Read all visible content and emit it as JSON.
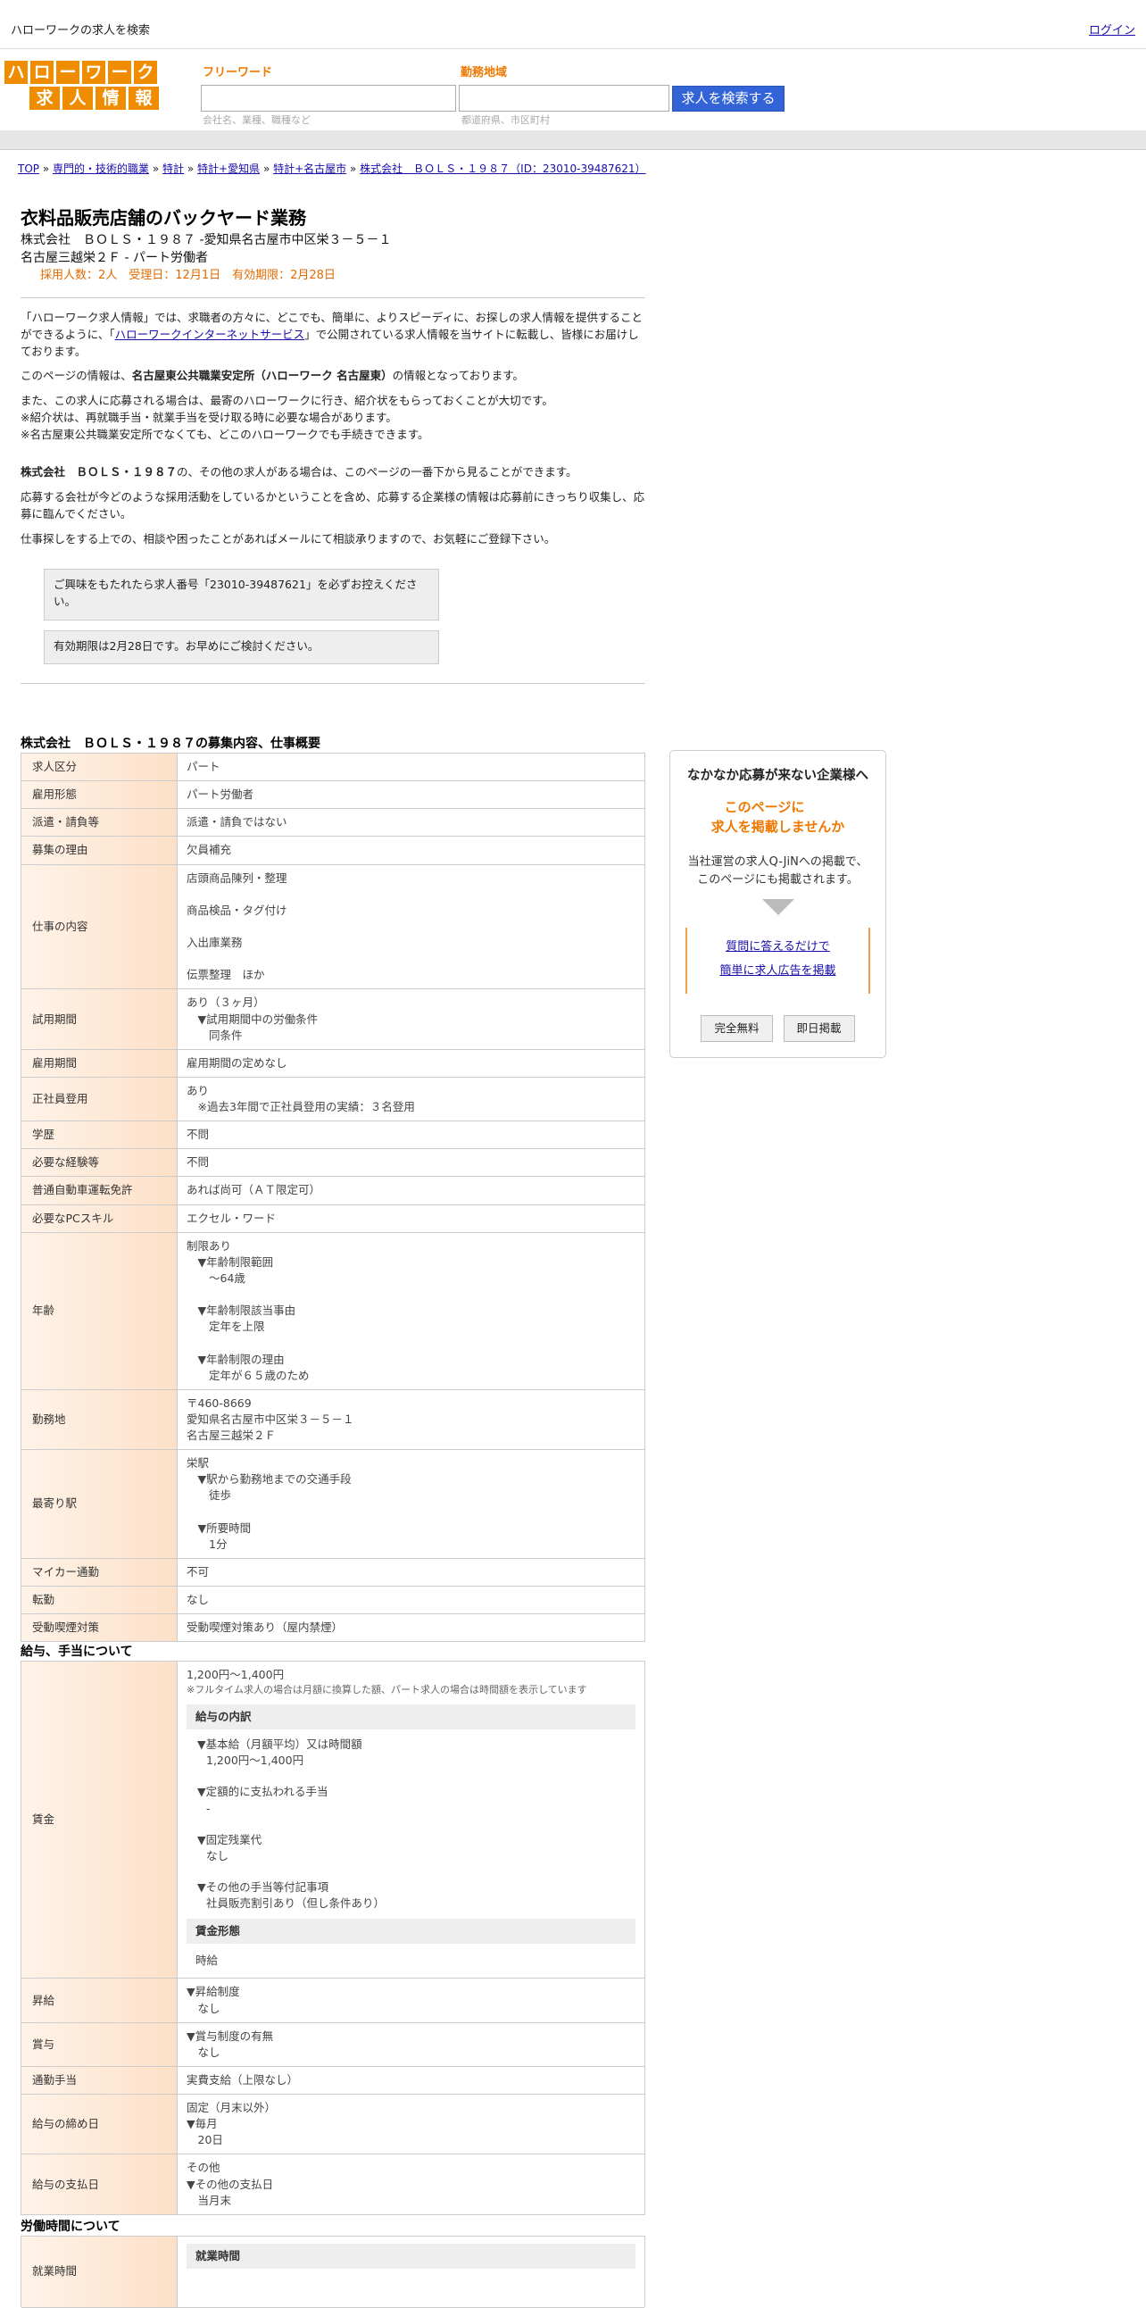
{
  "header": {
    "title": "ハローワークの求人を検索",
    "login": "ログイン"
  },
  "logo": {
    "row1": [
      "ハ",
      "ロ",
      "ー",
      "ワ",
      "ー",
      "ク"
    ],
    "row2": [
      "求",
      "人",
      "情",
      "報"
    ]
  },
  "search": {
    "keyword_label": "フリーワード",
    "area_label": "勤務地域",
    "keyword_hint": "会社名、業種、職種など",
    "area_hint": "都道府県、市区町村",
    "button": "求人を検索する"
  },
  "breadcrumb": [
    "TOP",
    "専門的・技術的職業",
    "特計",
    "特計+愛知県",
    "特計+名古屋市",
    "株式会社　ＢＯＬＳ・１９８７（ID：23010-39487621）"
  ],
  "breadcrumb_sep": "»",
  "job": {
    "title": "衣料品販売店舗のバックヤード業務",
    "line1": "株式会社　ＢＯＬＳ・１９８７ -愛知県名古屋市中区栄３－５－１",
    "line2": "名古屋三越栄２Ｆ - パート労働者",
    "meta": "採用人数：2人　受理日：12月1日　有効期限：2月28日"
  },
  "intro": {
    "p1a": "「ハローワーク求人情報」では、求職者の方々に、どこでも、簡単に、よりスピーディに、お探しの求人情報を提供することができるように、「",
    "p1link": "ハローワークインターネットサービス",
    "p1b": "」で公開されている求人情報を当サイトに転載し、皆様にお届けしております。",
    "p2a": "このページの情報は、",
    "p2b": "名古屋東公共職業安定所（ハローワーク 名古屋東）",
    "p2c": "の情報となっております。",
    "p3": "また、この求人に応募される場合は、最寄のハローワークに行き、紹介状をもらっておくことが大切です。",
    "p4": "※紹介状は、再就職手当・就業手当を受け取る時に必要な場合があります。",
    "p5": "※名古屋東公共職業安定所でなくても、どこのハローワークでも手続きできます。",
    "p6a": "株式会社　ＢＯＬＳ・１９８７",
    "p6b": "の、その他の求人がある場合は、このページの一番下から見ることができます。",
    "p7": "応募する会社が今どのような採用活動をしているかということを含め、応募する企業様の情報は応募前にきっちり収集し、応募に臨んでください。",
    "p8": "仕事探しをする上での、相談や困ったことがあればメールにて相談承りますので、お気軽にご登録下さい。"
  },
  "notes": {
    "n1": "ご興味をもたれたら求人番号「23010-39487621」を必ずお控えください。",
    "n2": "有効期限は2月28日です。お早めにご検討ください。"
  },
  "section1": {
    "title": "株式会社　ＢＯＬＳ・１９８７の募集内容、仕事概要",
    "rows": [
      {
        "h": "求人区分",
        "v": [
          "パート"
        ]
      },
      {
        "h": "雇用形態",
        "v": [
          "パート労働者"
        ]
      },
      {
        "h": "派遣・請負等",
        "v": [
          "派遣・請負ではない"
        ]
      },
      {
        "h": "募集の理由",
        "v": [
          "欠員補充"
        ]
      },
      {
        "h": "仕事の内容",
        "v": [
          "店頭商品陳列・整理",
          "",
          "商品検品・タグ付け",
          "",
          "入出庫業務",
          "",
          "伝票整理　ほか"
        ]
      },
      {
        "h": "試用期間",
        "v": [
          "あり（３ヶ月）",
          "　▼試用期間中の労働条件",
          "　　同条件"
        ]
      },
      {
        "h": "雇用期間",
        "v": [
          "雇用期間の定めなし"
        ]
      },
      {
        "h": "正社員登用",
        "v": [
          "あり",
          "　※過去3年間で正社員登用の実績：３名登用"
        ]
      },
      {
        "h": "学歴",
        "v": [
          "不問"
        ]
      },
      {
        "h": "必要な経験等",
        "v": [
          "不問"
        ]
      },
      {
        "h": "普通自動車運転免許",
        "v": [
          "あれば尚可（ＡＴ限定可）"
        ]
      },
      {
        "h": "必要なPCスキル",
        "v": [
          "エクセル・ワード"
        ]
      },
      {
        "h": "年齢",
        "v": [
          "制限あり",
          "　▼年齢制限範囲",
          "　　〜64歳",
          "",
          "　▼年齢制限該当事由",
          "　　定年を上限",
          "",
          "　▼年齢制限の理由",
          "　　定年が６５歳のため"
        ]
      },
      {
        "h": "勤務地",
        "v": [
          "〒460-8669",
          "愛知県名古屋市中区栄３－５－１",
          "名古屋三越栄２Ｆ"
        ]
      },
      {
        "h": "最寄り駅",
        "v": [
          "栄駅",
          "　▼駅から勤務地までの交通手段",
          "　　徒歩",
          "",
          "　▼所要時間",
          "　　1分"
        ]
      },
      {
        "h": "マイカー通勤",
        "v": [
          "不可"
        ]
      },
      {
        "h": "転勤",
        "v": [
          "なし"
        ]
      },
      {
        "h": "受動喫煙対策",
        "v": [
          "受動喫煙対策あり（屋内禁煙）"
        ]
      }
    ]
  },
  "section2": {
    "title": "給与、手当について",
    "wage": {
      "h": "賃金",
      "l1": "1,200円〜1,400円",
      "note": "※フルタイム求人の場合は月額に換算した額、パート求人の場合は時間額を表示しています",
      "sub1": "給与の内訳",
      "items": [
        "▼基本給（月額平均）又は時間額",
        "1,200円〜1,400円",
        "▼定額的に支払われる手当",
        "-",
        "▼固定残業代",
        "なし",
        "▼その他の手当等付記事項",
        "社員販売割引あり（但し条件あり）"
      ],
      "sub2": "賃金形態",
      "form": "時給"
    },
    "rows": [
      {
        "h": "昇給",
        "v": [
          "▼昇給制度",
          "　なし"
        ]
      },
      {
        "h": "賞与",
        "v": [
          "▼賞与制度の有無",
          "　なし"
        ]
      },
      {
        "h": "通勤手当",
        "v": [
          "実費支給（上限なし）"
        ]
      },
      {
        "h": "給与の締め日",
        "v": [
          "固定（月末以外）",
          "▼毎月",
          "　20日"
        ]
      },
      {
        "h": "給与の支払日",
        "v": [
          "その他",
          "▼その他の支払日",
          "　当月末"
        ]
      }
    ]
  },
  "section3": {
    "title": "労働時間について",
    "h": "就業時間",
    "sub": "就業時間"
  },
  "ad": {
    "title": "なかなか応募が来ない企業様へ",
    "orange1": "このページに",
    "orange2": "求人を掲載しませんか",
    "desc1": "当社運営の求人Q-JiNへの掲載で、",
    "desc2": "このページにも掲載されます。",
    "link1": "質問に答えるだけで",
    "link2": "簡単に求人広告を掲載",
    "btn1": "完全無料",
    "btn2": "即日掲載"
  }
}
